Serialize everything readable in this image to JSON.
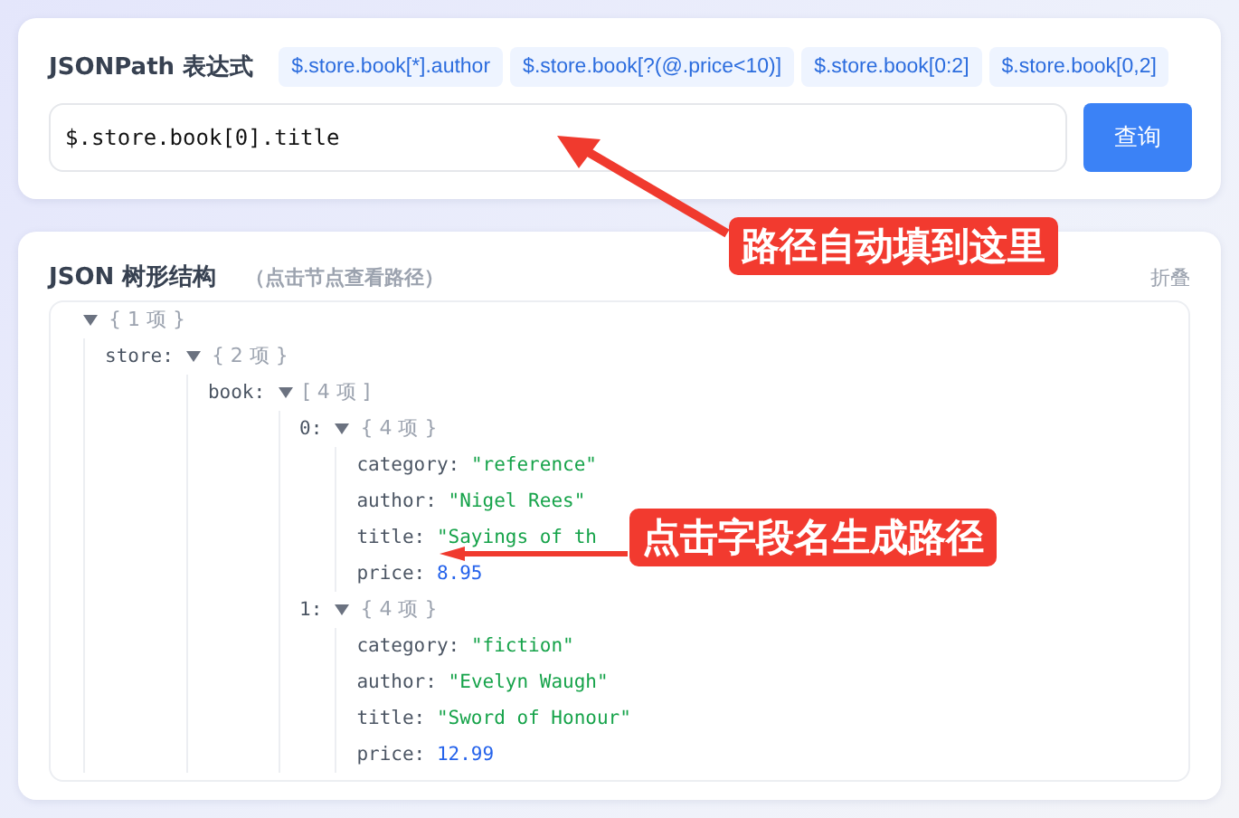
{
  "query_panel": {
    "title": "JSONPath 表达式",
    "examples": [
      "$.store.book[*].author",
      "$.store.book[?(@.price<10)]",
      "$.store.book[0:2]",
      "$.store.book[0,2]"
    ],
    "input_value": "$.store.book[0].title",
    "submit": "查询"
  },
  "tree_panel": {
    "title": "JSON 树形结构",
    "hint": "（点击节点查看路径）",
    "collapse": "折叠",
    "root": {
      "kind": "node",
      "expanded": true,
      "summary": "{ 1 项 }",
      "children": [
        {
          "kind": "node",
          "key": "store:",
          "expanded": true,
          "summary": "{ 2 项 }",
          "children": [
            {
              "kind": "node",
              "key": "book:",
              "expanded": true,
              "summary": "[ 4 项 ]",
              "children": [
                {
                  "kind": "node",
                  "key": "0:",
                  "expanded": true,
                  "summary": "{ 4 项 }",
                  "children": [
                    {
                      "kind": "string",
                      "key": "category:",
                      "value": "\"reference\""
                    },
                    {
                      "kind": "string",
                      "key": "author:",
                      "value": "\"Nigel Rees\""
                    },
                    {
                      "kind": "string",
                      "key": "title:",
                      "value": "\"Sayings of th"
                    },
                    {
                      "kind": "number",
                      "key": "price:",
                      "value": "8.95"
                    }
                  ]
                },
                {
                  "kind": "node",
                  "key": "1:",
                  "expanded": true,
                  "summary": "{ 4 项 }",
                  "children": [
                    {
                      "kind": "string",
                      "key": "category:",
                      "value": "\"fiction\""
                    },
                    {
                      "kind": "string",
                      "key": "author:",
                      "value": "\"Evelyn Waugh\""
                    },
                    {
                      "kind": "string",
                      "key": "title:",
                      "value": "\"Sword of Honour\""
                    },
                    {
                      "kind": "number",
                      "key": "price:",
                      "value": "12.99"
                    }
                  ]
                }
              ]
            }
          ]
        }
      ]
    }
  },
  "callouts": [
    "路径自动填到这里",
    "点击字段名生成路径"
  ]
}
